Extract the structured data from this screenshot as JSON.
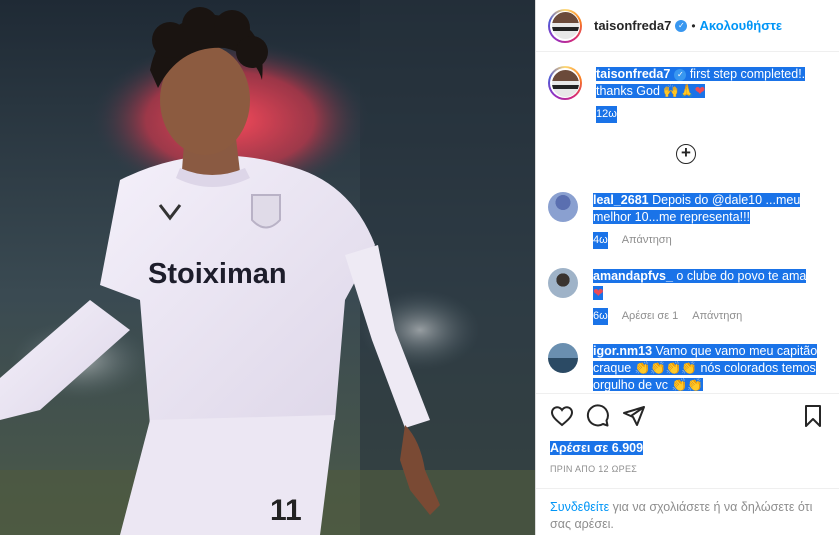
{
  "post": {
    "username": "taisonfreda7",
    "follow_label": "Ακολουθήστε",
    "dot": "•",
    "verified_icon": "✓"
  },
  "photo": {
    "shirt_text": "Stoiximan",
    "number_text": "11"
  },
  "caption": {
    "username": "taisonfreda7",
    "text": "first step completed!. thanks God",
    "emojis": [
      "raising-hands",
      "praying-hands",
      "red-heart"
    ],
    "time": "12ω"
  },
  "comments": [
    {
      "username": "leal_2681",
      "text": "Depois do @dale10 ...meu melhor 10...me representa!!!",
      "time": "4ω",
      "reply": "Απάντηση",
      "likes": ""
    },
    {
      "username": "amandapfvs_",
      "text": "o clube do povo te ama",
      "time": "6ω",
      "likes": "Αρέσει σε 1",
      "reply": "Απάντηση"
    },
    {
      "username": "igor.nm13",
      "text": "Vamo que vamo meu capitão craque",
      "text2": "nós colorados temos orgulho de vc",
      "time": "",
      "reply": "",
      "likes": ""
    }
  ],
  "likes_text": "Αρέσει σε 6.909",
  "post_time": "ΠΡΙΝ ΑΠΟ 12 ΩΡΕΣ",
  "add_comment": {
    "login_link": "Συνδεθείτε",
    "rest": "για να σχολιάσετε ή να δηλώσετε ότι σας αρέσει."
  },
  "colors": {
    "accent": "#0095f6",
    "selection": "#1a73e8",
    "verified": "#3897f0"
  }
}
